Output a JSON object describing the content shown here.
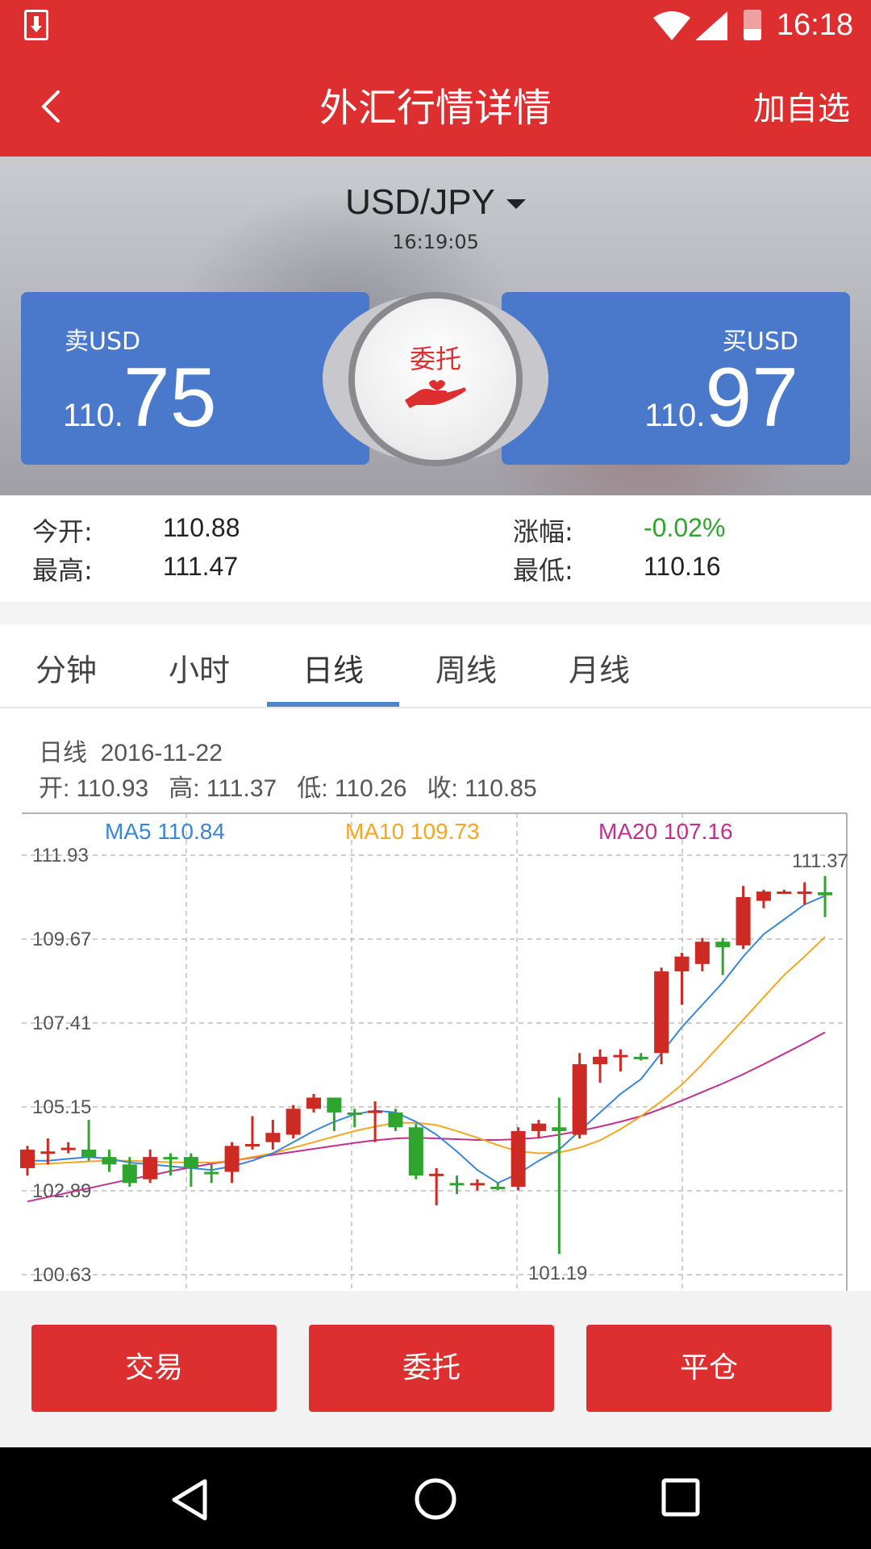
{
  "status_bar": {
    "time": "16:18"
  },
  "header": {
    "title": "外汇行情详情",
    "add_favorite": "加自选"
  },
  "quote": {
    "pair": "USD/JPY",
    "time": "16:19:05",
    "sell_label": "卖USD",
    "sell_price_prefix": "110.",
    "sell_price_main": "75",
    "buy_label": "买USD",
    "buy_price_prefix": "110.",
    "buy_price_main": "97",
    "entrust_label": "委托"
  },
  "stats": {
    "open_label": "今开:",
    "open_value": "110.88",
    "high_label": "最高:",
    "high_value": "111.47",
    "change_label": "涨幅:",
    "change_value": "-0.02%",
    "low_label": "最低:",
    "low_value": "110.16"
  },
  "tabs": [
    "分钟",
    "小时",
    "日线",
    "周线",
    "月线"
  ],
  "kline_info": {
    "period": "日线",
    "date": "2016-11-22",
    "open": "开: 110.93",
    "high": "高: 111.37",
    "low": "低: 110.26",
    "close": "收: 110.85"
  },
  "chart_data": {
    "type": "candlestick",
    "ma_legend": [
      {
        "label": "MA5 110.84",
        "color": "#3a86d6"
      },
      {
        "label": "MA10 109.73",
        "color": "#f5a623"
      },
      {
        "label": "MA20 107.16",
        "color": "#c0308f"
      }
    ],
    "y_ticks": [
      "111.93",
      "109.67",
      "107.41",
      "105.15",
      "102.89",
      "100.63"
    ],
    "ylim": [
      100.63,
      111.93
    ],
    "annotations": {
      "max_label": "111.37",
      "min_label": "101.19"
    },
    "up_color": "#cc2a22",
    "down_color": "#2ea52e",
    "candles": [
      {
        "o": 103.5,
        "c": 104.0,
        "h": 104.1,
        "l": 103.3
      },
      {
        "o": 103.9,
        "c": 103.95,
        "h": 104.3,
        "l": 103.6
      },
      {
        "o": 104.0,
        "c": 104.05,
        "h": 104.2,
        "l": 103.9
      },
      {
        "o": 104.0,
        "c": 103.8,
        "h": 104.8,
        "l": 103.7
      },
      {
        "o": 103.8,
        "c": 103.6,
        "h": 104.0,
        "l": 103.4
      },
      {
        "o": 103.6,
        "c": 103.1,
        "h": 103.8,
        "l": 103.0
      },
      {
        "o": 103.2,
        "c": 103.8,
        "h": 104.0,
        "l": 103.1
      },
      {
        "o": 103.8,
        "c": 103.75,
        "h": 103.9,
        "l": 103.3
      },
      {
        "o": 103.8,
        "c": 103.5,
        "h": 103.9,
        "l": 103.0
      },
      {
        "o": 103.4,
        "c": 103.35,
        "h": 103.6,
        "l": 103.1
      },
      {
        "o": 103.4,
        "c": 104.1,
        "h": 104.2,
        "l": 103.1
      },
      {
        "o": 104.1,
        "c": 104.15,
        "h": 104.9,
        "l": 104.0
      },
      {
        "o": 104.2,
        "c": 104.45,
        "h": 104.8,
        "l": 104.0
      },
      {
        "o": 104.4,
        "c": 105.1,
        "h": 105.2,
        "l": 104.3
      },
      {
        "o": 105.1,
        "c": 105.4,
        "h": 105.5,
        "l": 105.0
      },
      {
        "o": 105.4,
        "c": 105.0,
        "h": 105.4,
        "l": 104.5
      },
      {
        "o": 105.0,
        "c": 104.95,
        "h": 105.1,
        "l": 104.6
      },
      {
        "o": 105.0,
        "c": 105.05,
        "h": 105.3,
        "l": 104.2
      },
      {
        "o": 105.0,
        "c": 104.6,
        "h": 105.1,
        "l": 104.5
      },
      {
        "o": 104.6,
        "c": 103.3,
        "h": 104.7,
        "l": 103.2
      },
      {
        "o": 103.3,
        "c": 103.35,
        "h": 103.5,
        "l": 102.5
      },
      {
        "o": 103.1,
        "c": 103.05,
        "h": 103.3,
        "l": 102.8
      },
      {
        "o": 103.05,
        "c": 103.1,
        "h": 103.2,
        "l": 102.9
      },
      {
        "o": 103.0,
        "c": 102.95,
        "h": 103.1,
        "l": 102.9
      },
      {
        "o": 103.0,
        "c": 104.5,
        "h": 104.6,
        "l": 102.9
      },
      {
        "o": 104.5,
        "c": 104.7,
        "h": 104.8,
        "l": 104.3
      },
      {
        "o": 104.6,
        "c": 104.5,
        "h": 105.4,
        "l": 101.19
      },
      {
        "o": 104.4,
        "c": 106.3,
        "h": 106.6,
        "l": 104.3
      },
      {
        "o": 106.3,
        "c": 106.5,
        "h": 106.7,
        "l": 105.8
      },
      {
        "o": 106.5,
        "c": 106.55,
        "h": 106.7,
        "l": 106.1
      },
      {
        "o": 106.5,
        "c": 106.45,
        "h": 106.6,
        "l": 106.4
      },
      {
        "o": 106.6,
        "c": 108.8,
        "h": 108.9,
        "l": 106.3
      },
      {
        "o": 108.8,
        "c": 109.2,
        "h": 109.3,
        "l": 107.9
      },
      {
        "o": 109.0,
        "c": 109.6,
        "h": 109.7,
        "l": 108.8
      },
      {
        "o": 109.6,
        "c": 109.45,
        "h": 109.7,
        "l": 108.7
      },
      {
        "o": 109.5,
        "c": 110.8,
        "h": 111.1,
        "l": 109.4
      },
      {
        "o": 110.7,
        "c": 110.95,
        "h": 111.0,
        "l": 110.5
      },
      {
        "o": 110.9,
        "c": 110.95,
        "h": 111.0,
        "l": 110.9
      },
      {
        "o": 110.9,
        "c": 110.95,
        "h": 111.2,
        "l": 110.6
      },
      {
        "o": 110.93,
        "c": 110.85,
        "h": 111.37,
        "l": 110.26
      }
    ],
    "ma5": [
      103.7,
      103.7,
      103.75,
      103.8,
      103.75,
      103.65,
      103.6,
      103.55,
      103.5,
      103.45,
      103.55,
      103.7,
      103.9,
      104.2,
      104.5,
      104.75,
      104.95,
      105.05,
      105.0,
      104.75,
      104.4,
      103.95,
      103.45,
      103.1,
      103.35,
      103.7,
      104.0,
      104.5,
      105.0,
      105.5,
      105.9,
      106.6,
      107.3,
      107.9,
      108.5,
      109.2,
      109.8,
      110.2,
      110.6,
      110.84
    ],
    "ma10": [
      103.6,
      103.62,
      103.65,
      103.68,
      103.7,
      103.7,
      103.68,
      103.66,
      103.65,
      103.65,
      103.7,
      103.8,
      103.9,
      104.05,
      104.2,
      104.35,
      104.5,
      104.62,
      104.72,
      104.72,
      104.66,
      104.5,
      104.32,
      104.12,
      103.95,
      103.9,
      103.92,
      104.05,
      104.25,
      104.55,
      104.9,
      105.3,
      105.75,
      106.3,
      106.9,
      107.5,
      108.1,
      108.7,
      109.2,
      109.73
    ],
    "ma20": [
      102.6,
      102.72,
      102.84,
      102.96,
      103.08,
      103.2,
      103.3,
      103.42,
      103.52,
      103.62,
      103.7,
      103.78,
      103.86,
      103.94,
      104.02,
      104.1,
      104.18,
      104.25,
      104.3,
      104.32,
      104.3,
      104.28,
      104.26,
      104.26,
      104.28,
      104.32,
      104.4,
      104.5,
      104.62,
      104.75,
      104.9,
      105.1,
      105.32,
      105.55,
      105.78,
      106.03,
      106.3,
      106.58,
      106.86,
      107.16
    ]
  },
  "actions": {
    "trade": "交易",
    "entrust": "委托",
    "close_position": "平仓"
  }
}
